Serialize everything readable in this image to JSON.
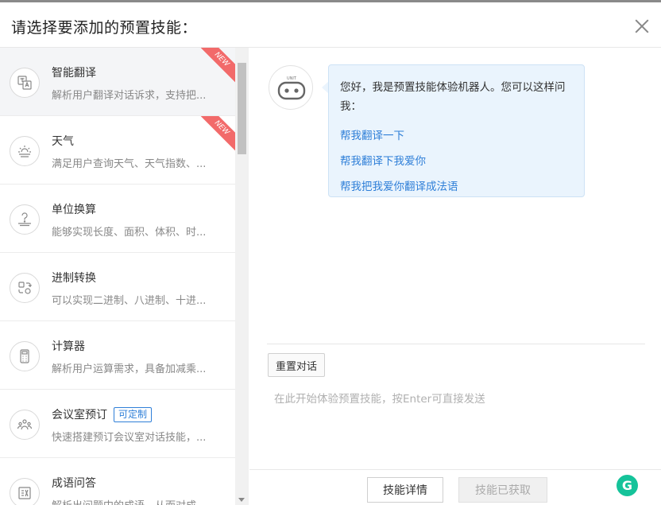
{
  "dialog": {
    "title": "请选择要添加的预置技能：",
    "close_label": "×"
  },
  "skills": [
    {
      "name": "智能翻译",
      "desc": "解析用户翻译对话诉求，支持把...",
      "badge": "NEW",
      "icon": "translate-icon"
    },
    {
      "name": "天气",
      "desc": "满足用户查询天气、天气指数、...",
      "badge": "NEW",
      "icon": "weather-icon"
    },
    {
      "name": "单位换算",
      "desc": "能够实现长度、面积、体积、时...",
      "icon": "scale-icon"
    },
    {
      "name": "进制转换",
      "desc": "可以实现二进制、八进制、十进...",
      "icon": "convert-icon"
    },
    {
      "name": "计算器",
      "desc": "解析用户运算需求，具备加减乘...",
      "icon": "calculator-icon"
    },
    {
      "name": "会议室预订",
      "desc": "快速搭建预订会议室对话技能，...",
      "tag": "可定制",
      "icon": "meeting-icon"
    },
    {
      "name": "成语问答",
      "desc": "解析出问题中的成语，从而对成...",
      "icon": "idiom-icon"
    }
  ],
  "chat": {
    "bot_label": "UNIT",
    "greeting": "您好，我是预置技能体验机器人。您可以这样问我：",
    "suggestions": [
      "帮我翻译一下",
      "帮我翻译下我爱你",
      "帮我把我爱你翻译成法语"
    ],
    "reset_label": "重置对话",
    "input_placeholder": "在此开始体验预置技能，按Enter可直接发送"
  },
  "footer": {
    "detail_label": "技能详情",
    "acquired_label": "技能已获取"
  },
  "colors": {
    "accent": "#2f7fd8",
    "badge": "#f26a6a",
    "bubble_bg": "#eaf4fd"
  }
}
